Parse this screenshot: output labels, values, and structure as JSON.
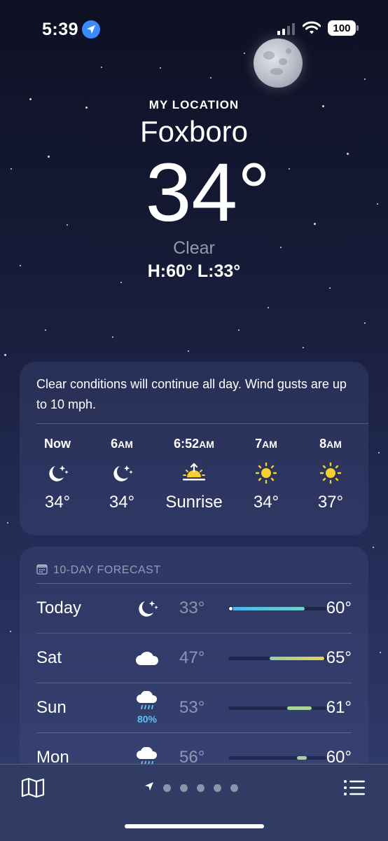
{
  "status_bar": {
    "time": "5:39",
    "battery": "100",
    "icons": [
      "location-arrow-icon",
      "cellular-signal-icon",
      "wifi-icon",
      "battery-icon"
    ]
  },
  "header": {
    "location_label": "MY LOCATION",
    "city": "Foxboro",
    "temperature": "34°",
    "condition": "Clear",
    "high_low": "H:60°  L:33°"
  },
  "hourly": {
    "summary": "Clear conditions will continue all day. Wind gusts are up to 10 mph.",
    "hours": [
      {
        "label": "Now",
        "suffix": "",
        "icon": "moon-stars-icon",
        "value": "34°"
      },
      {
        "label": "6",
        "suffix": "AM",
        "icon": "moon-stars-icon",
        "value": "34°"
      },
      {
        "label": "6:52",
        "suffix": "AM",
        "icon": "sunrise-icon",
        "value": "Sunrise"
      },
      {
        "label": "7",
        "suffix": "AM",
        "icon": "sun-icon",
        "value": "34°"
      },
      {
        "label": "8",
        "suffix": "AM",
        "icon": "sun-icon",
        "value": "37°"
      }
    ]
  },
  "forecast": {
    "title": "10-DAY FORECAST",
    "days": [
      {
        "day": "Today",
        "icon": "moon-stars-icon",
        "precip": "",
        "low": "33°",
        "high": "60°",
        "range_start": 0.0,
        "range_end": 0.78,
        "current_marker": 0.02
      },
      {
        "day": "Sat",
        "icon": "cloud-icon",
        "precip": "",
        "low": "47°",
        "high": "65°",
        "range_start": 0.42,
        "range_end": 0.98
      },
      {
        "day": "Sun",
        "icon": "cloud-rain-icon",
        "precip": "80%",
        "low": "53°",
        "high": "61°",
        "range_start": 0.6,
        "range_end": 0.85
      },
      {
        "day": "Mon",
        "icon": "cloud-rain-icon",
        "precip": "",
        "low": "56°",
        "high": "60°",
        "range_start": 0.7,
        "range_end": 0.8
      }
    ]
  },
  "bottom_bar": {
    "icons": [
      "map-icon",
      "location-arrow-icon",
      "list-icon"
    ],
    "page_count": 5
  },
  "colors": {
    "accent_blue": "#3a8bfd",
    "precip_blue": "#5ec2f5",
    "sun_yellow": "#f8cf2c"
  }
}
